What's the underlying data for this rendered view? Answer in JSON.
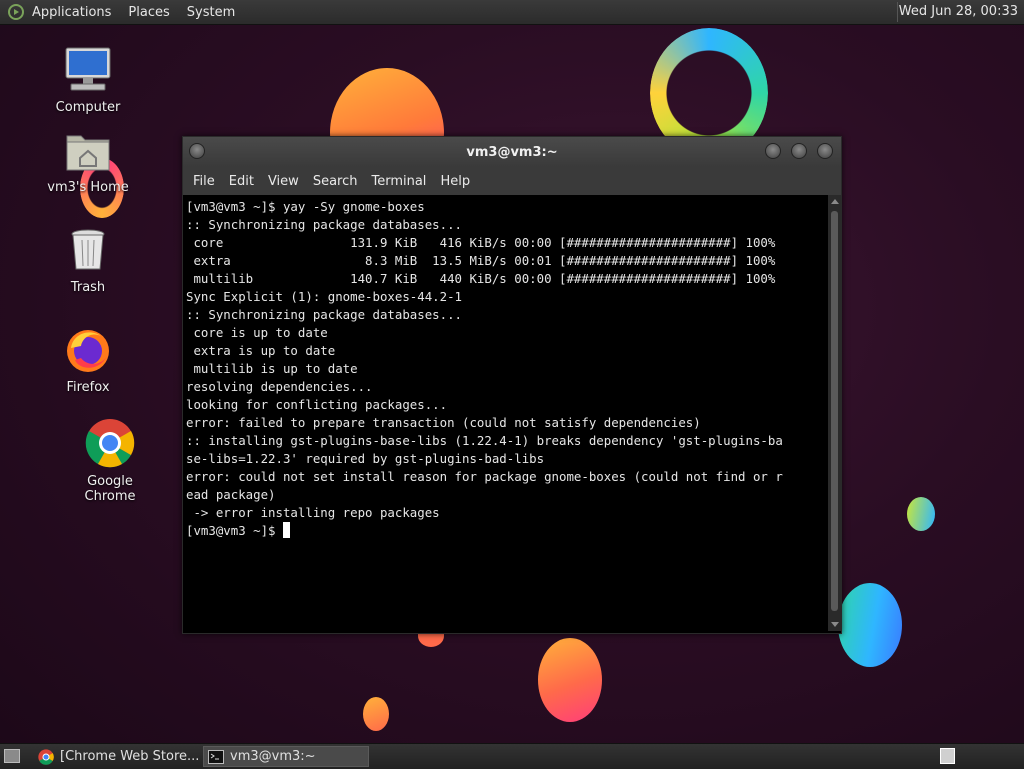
{
  "top_panel": {
    "menus": [
      "Applications",
      "Places",
      "System"
    ],
    "clock": "Wed Jun 28, 00:33"
  },
  "desktop_icons": [
    {
      "label": "Computer",
      "icon": "computer-icon"
    },
    {
      "label": "vm3's Home",
      "icon": "home-folder-icon"
    },
    {
      "label": "Trash",
      "icon": "trash-icon"
    },
    {
      "label": "Firefox",
      "icon": "firefox-icon"
    },
    {
      "label": "Google Chrome",
      "icon": "chrome-icon"
    }
  ],
  "terminal": {
    "title": "vm3@vm3:~",
    "menus": [
      "File",
      "Edit",
      "View",
      "Search",
      "Terminal",
      "Help"
    ],
    "lines": [
      "[vm3@vm3 ~]$ yay -Sy gnome-boxes",
      ":: Synchronizing package databases...",
      " core                 131.9 KiB   416 KiB/s 00:00 [######################] 100%",
      " extra                  8.3 MiB  13.5 MiB/s 00:01 [######################] 100%",
      " multilib             140.7 KiB   440 KiB/s 00:00 [######################] 100%",
      "Sync Explicit (1): gnome-boxes-44.2-1",
      ":: Synchronizing package databases...",
      " core is up to date",
      " extra is up to date",
      " multilib is up to date",
      "resolving dependencies...",
      "looking for conflicting packages...",
      "error: failed to prepare transaction (could not satisfy dependencies)",
      ":: installing gst-plugins-base-libs (1.22.4-1) breaks dependency 'gst-plugins-ba",
      "se-libs=1.22.3' required by gst-plugins-bad-libs",
      "error: could not set install reason for package gnome-boxes (could not find or r",
      "ead package)",
      " -> error installing repo packages"
    ],
    "prompt": "[vm3@vm3 ~]$ "
  },
  "taskbar": {
    "tasks": [
      {
        "label": "[Chrome Web Store...",
        "icon": "chrome-icon"
      },
      {
        "label": "vm3@vm3:~",
        "icon": "terminal-icon"
      }
    ]
  }
}
